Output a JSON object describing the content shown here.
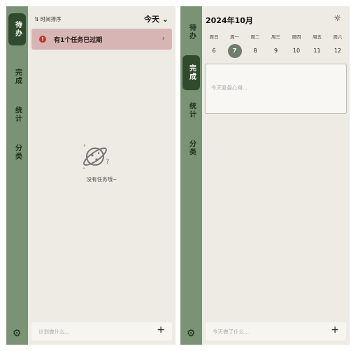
{
  "left": {
    "sidebar": [
      {
        "label": "待办",
        "active": true
      },
      {
        "label": "完成",
        "active": false
      },
      {
        "label": "统计",
        "active": false
      },
      {
        "label": "分类",
        "active": false
      }
    ],
    "sort_label": "⇅ 时间排序",
    "today_label": "今天 ⌄",
    "overdue_text": "有1个任务已过期",
    "overdue_icon": "!",
    "overdue_chevron": "›",
    "empty_text": "没有任务哦~",
    "input_placeholder": "计划做什么...",
    "plus": "+",
    "gear": "⚙"
  },
  "right": {
    "sidebar": [
      {
        "label": "待办",
        "active": false
      },
      {
        "label": "完成",
        "active": true
      },
      {
        "label": "统计",
        "active": false
      },
      {
        "label": "分类",
        "active": false
      }
    ],
    "month_title": "2024年10月",
    "sun_icon": "☼",
    "weekdays": [
      "周日",
      "周一",
      "周二",
      "周三",
      "周四",
      "周五",
      "周六"
    ],
    "dates": [
      "6",
      "7",
      "8",
      "9",
      "10",
      "11",
      "12"
    ],
    "selected_date": "7",
    "journal_placeholder": "今天复盘心得...",
    "input_placeholder": "今天做了什么...",
    "plus": "+",
    "gear": "⚙"
  },
  "colors": {
    "sidebar": "#7a9375",
    "sidebar_active": "#2f4a2d",
    "overdue_bg": "#d8b5b5",
    "page_bg": "#eeebe4"
  }
}
